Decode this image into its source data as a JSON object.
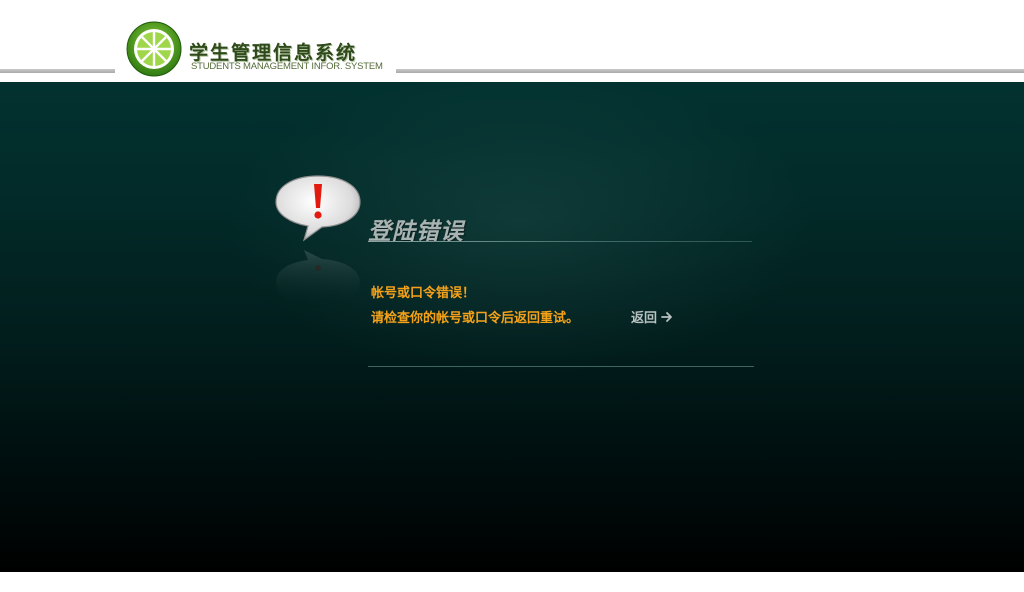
{
  "header": {
    "app_title": "学生管理信息系统",
    "app_subtitle": "STUDENTS MANAGEMENT INFOR. SYSTEM",
    "logo_icon": "lime-slice-icon"
  },
  "error": {
    "heading": "登陆错误",
    "icon": "exclamation-speech-bubble-icon",
    "message": "帐号或口令错误！",
    "hint": "请检查你的帐号或口令后返回重试。",
    "back_label": "返回",
    "back_icon": "arrow-right-icon"
  },
  "colors": {
    "message": "#f5a219",
    "link": "#b8c2c1",
    "panel_top": "#023230",
    "panel_bottom": "#000000"
  }
}
